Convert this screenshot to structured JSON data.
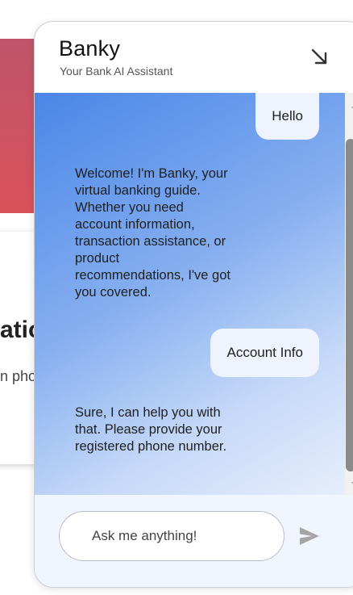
{
  "background": {
    "heading_fragment": "atio",
    "subtext_fragment": "n pho"
  },
  "chat": {
    "title": "Banky",
    "subtitle": "Your Bank AI Assistant",
    "minimize_icon": "arrow-down-right-icon",
    "messages": [
      {
        "role": "user",
        "text": "Hello"
      },
      {
        "role": "bot",
        "text": "Welcome! I'm Banky, your virtual banking guide. Whether you need account information, transaction assistance, or product recommendations, I've got you covered."
      },
      {
        "role": "user",
        "text": "Account Info"
      },
      {
        "role": "bot",
        "text": "Sure, I can help you with that. Please provide your registered phone number."
      }
    ],
    "input": {
      "placeholder": "Ask me anything!",
      "value": ""
    },
    "send_icon": "send-icon"
  },
  "colors": {
    "gradient_start": "#4a86e8",
    "gradient_end": "#e6eefc",
    "user_bubble": "#eef3fd",
    "footer_bg": "#f1f5fd"
  }
}
